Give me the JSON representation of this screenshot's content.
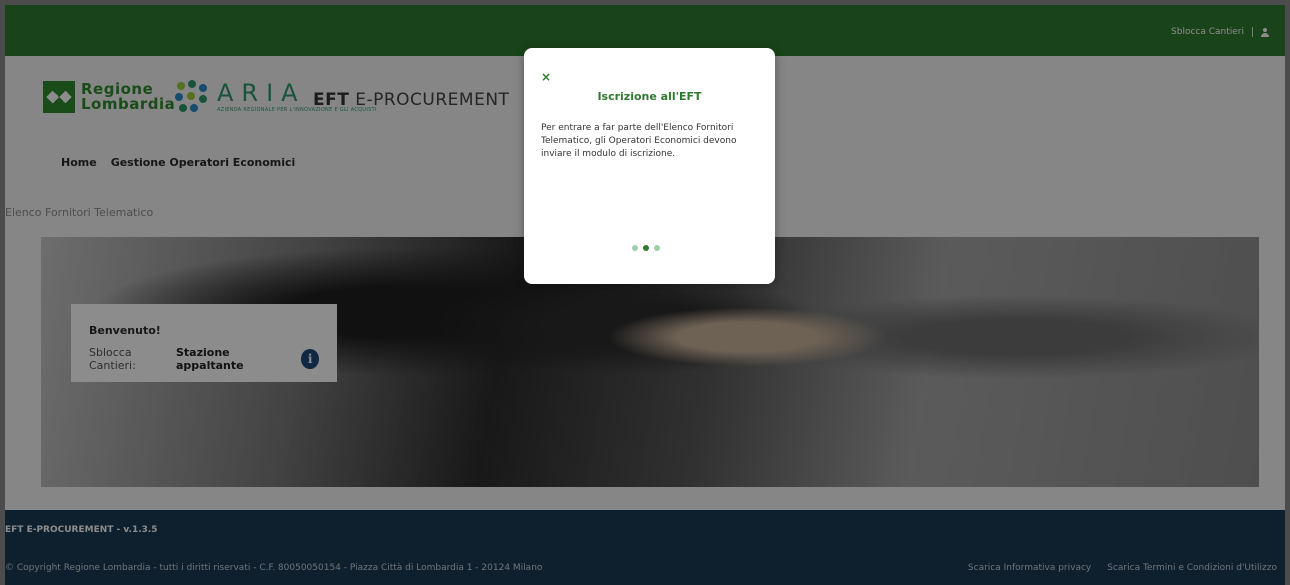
{
  "topbar": {
    "user_label": "Sblocca Cantieri"
  },
  "branding": {
    "regione_line1": "Regione",
    "regione_line2": "Lombardia",
    "aria_word": "ARIA",
    "aria_tagline": "AZIENDA REGIONALE PER L'INNOVAZIONE E GLI ACQUISTI",
    "app_title_bold": "EFT",
    "app_title_rest": " E-PROCUREMENT"
  },
  "nav": {
    "items": [
      {
        "label": "Home"
      },
      {
        "label": "Gestione Operatori Economici"
      }
    ]
  },
  "page": {
    "heading": "Elenco Fornitori Telematico"
  },
  "welcome": {
    "title": "Benvenuto!",
    "role_prefix": "Sblocca Cantieri: ",
    "role_name": "Stazione appaltante",
    "info_glyph": "i"
  },
  "footer": {
    "version": "EFT E-PROCUREMENT - v.1.3.5",
    "copyright": "© Copyright Regione Lombardia - tutti i diritti riservati - C.F. 80050050154 - Piazza Città di Lombardia 1 - 20124 Milano",
    "links": [
      {
        "label": "Scarica Informativa privacy"
      },
      {
        "label": "Scarica Termini e Condizioni d'Utilizzo"
      }
    ]
  },
  "modal": {
    "close_glyph": "×",
    "title": "Iscrizione all'EFT",
    "body": "Per entrare a far parte dell'Elenco Fornitori Telematico, gli Operatori Economici devono inviare il modulo di iscrizione.",
    "pager": {
      "total": 3,
      "current": 2
    }
  },
  "colors": {
    "brand_green": "#2f7a2f",
    "footer_navy": "#1b3a55",
    "info_blue": "#1f4a7a"
  }
}
